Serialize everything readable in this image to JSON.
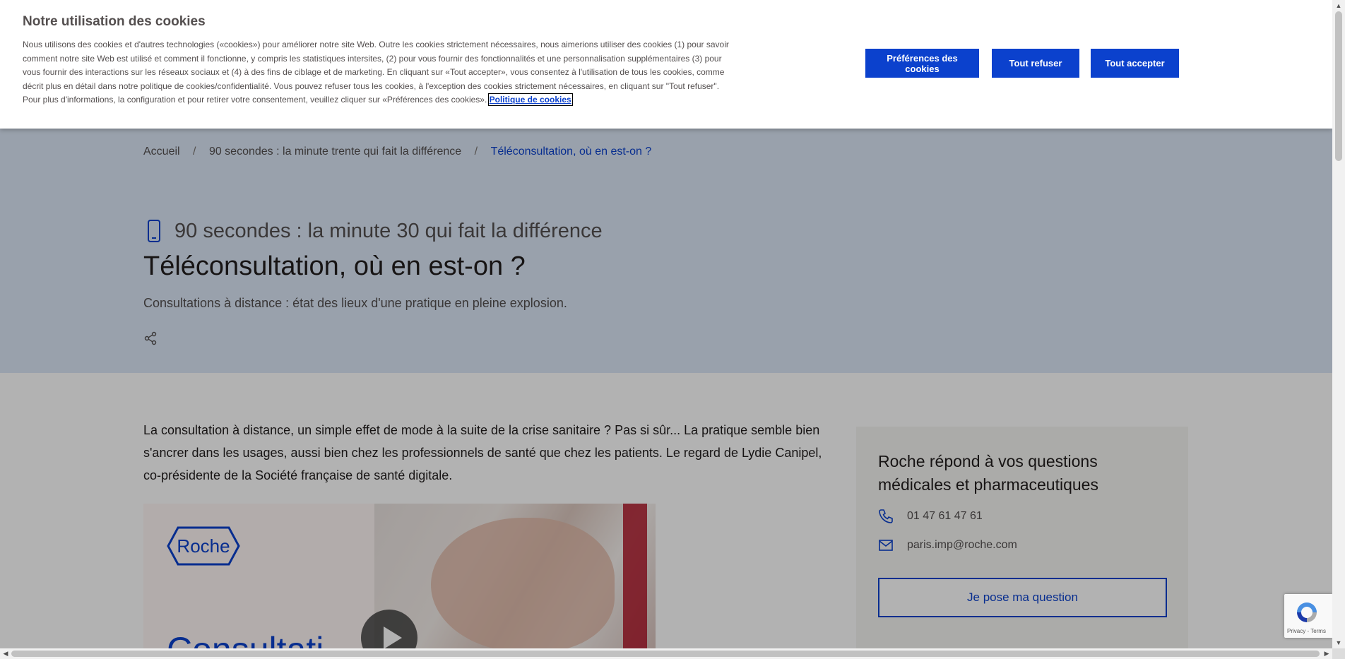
{
  "colors": {
    "accent": "#0b41cd",
    "hero_bg": "#dbe7f7",
    "text": "#544f4f"
  },
  "cookie_banner": {
    "title": "Notre utilisation des cookies",
    "text": "Nous utilisons des cookies et d'autres technologies («cookies») pour améliorer notre site Web. Outre les cookies strictement nécessaires, nous aimerions utiliser des cookies (1) pour savoir comment notre site Web est utilisé et comment il fonctionne, y compris les statistiques intersites, (2) pour vous fournir des fonctionnalités et une personnalisation supplémentaires (3) pour vous fournir des interactions sur les réseaux sociaux et (4) à des fins de ciblage et de marketing. En cliquant sur «Tout accepter», vous consentez à l'utilisation de tous les cookies, comme décrit plus en détail dans notre politique de cookies/confidentialité. Vous pouvez refuser tous les cookies, à l'exception des cookies strictement nécessaires, en cliquant sur \"Tout refuser\". Pour plus d'informations, la configuration et pour retirer votre consentement, veuillez cliquer sur «Préférences des cookies».",
    "policy_link": "Politique de cookies",
    "buttons": {
      "preferences": "Préférences des cookies",
      "refuse_all": "Tout refuser",
      "accept_all": "Tout accepter"
    }
  },
  "breadcrumb": {
    "items": [
      "Accueil",
      "90 secondes : la minute trente qui fait la différence",
      "Téléconsultation, où en est-on ?"
    ],
    "separator": "/"
  },
  "hero": {
    "eyebrow_icon": "smartphone-icon",
    "eyebrow": "90 secondes : la minute 30 qui fait la différence",
    "title": "Téléconsultation, où en est-on ?",
    "subtitle": "Consultations à distance : état des lieux d'une pratique en pleine explosion.",
    "share_icon": "share-icon"
  },
  "article": {
    "intro": "La consultation à distance, un simple effet de mode à la suite de la crise sanitaire ? Pas si sûr... La pratique semble bien s'ancrer dans les usages, aussi bien chez les professionnels de santé que chez les patients. Le regard de Lydie Canipel, co-présidente de la Société française de santé digitale.",
    "media": {
      "logo_text": "Roche",
      "big_text": "Consultati",
      "play_icon": "play-icon"
    }
  },
  "sidebar_card": {
    "title": "Roche répond à vos questions médicales et pharmaceutiques",
    "phone_icon": "phone-icon",
    "phone": "01 47 61 47 61",
    "email_icon": "mail-icon",
    "email": "paris.imp@roche.com",
    "button": "Je pose ma question"
  },
  "recaptcha": {
    "links": "Privacy - Terms"
  },
  "scrollbars": {
    "up": "▲",
    "down": "▼",
    "left": "◀",
    "right": "▶"
  }
}
